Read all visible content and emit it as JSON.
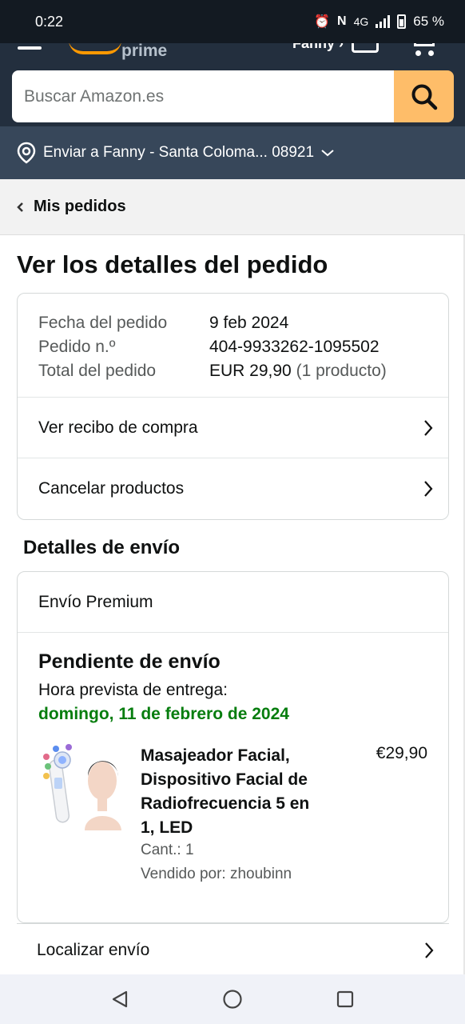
{
  "status_bar": {
    "time": "0:22",
    "network": "4G",
    "battery": "65 %"
  },
  "header": {
    "logo_text": "prime",
    "user_name": "Fanny ›",
    "search": {
      "placeholder": "Buscar Amazon.es"
    },
    "deliver_to": "Enviar a Fanny - Santa Coloma... 08921"
  },
  "breadcrumb": {
    "label": "Mis pedidos"
  },
  "page_title": "Ver los detalles del pedido",
  "order_summary": {
    "rows": [
      {
        "label": "Fecha del pedido",
        "value": "9 feb 2024",
        "extra": ""
      },
      {
        "label": "Pedido n.º",
        "value": "404-9933262-1095502",
        "extra": ""
      },
      {
        "label": "Total del pedido",
        "value": "EUR 29,90",
        "extra": "(1 producto)"
      }
    ],
    "links": [
      {
        "label": "Ver recibo de compra"
      },
      {
        "label": "Cancelar productos"
      }
    ]
  },
  "shipping": {
    "section_title": "Detalles de envío",
    "method": "Envío Premium",
    "status": "Pendiente de envío",
    "eta_label": "Hora prevista de entrega:",
    "eta_date": "domingo, 11 de febrero de 2024",
    "item": {
      "title": "Masajeador Facial, Dispositivo Facial de Radiofrecuencia 5 en 1, LED",
      "price": "€29,90",
      "quantity": "Cant.: 1",
      "seller": "Vendido por: zhoubinn"
    },
    "track_label": "Localizar envío"
  },
  "colors": {
    "header_bg": "#232f3e",
    "deliver_bg": "#37475a",
    "search_button": "#febd69",
    "delivery_date": "#067d0e"
  }
}
